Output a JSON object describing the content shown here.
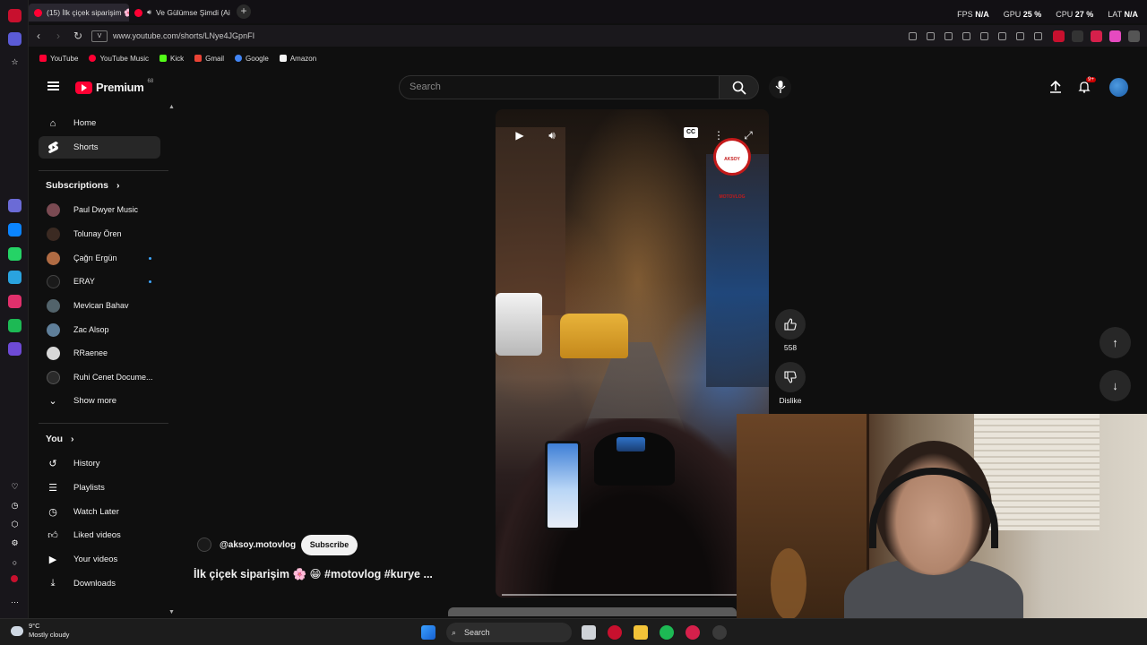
{
  "browser": {
    "tabs": [
      {
        "label": "(15) İlk çiçek siparişim 🌸 S",
        "active": true
      },
      {
        "label": "Ve Gülümse Şimdi (Ai",
        "active": false
      }
    ],
    "stats": {
      "fps_label": "FPS",
      "fps_value": "N/A",
      "gpu_label": "GPU",
      "gpu_value": "25 %",
      "cpu_label": "CPU",
      "cpu_value": "27 %",
      "lat_label": "LAT",
      "lat_value": "N/A"
    },
    "url": "www.youtube.com/shorts/LNye4JGpnFI",
    "vbadge": "V",
    "bookmarks": [
      "YouTube",
      "YouTube Music",
      "Kick",
      "Gmail",
      "Google",
      "Amazon"
    ]
  },
  "youtube": {
    "logo_text": "Premium",
    "logo_sup": "68",
    "search_placeholder": "Search",
    "notif_count": "9+",
    "sidebar": {
      "main": [
        {
          "label": "Home",
          "icon": "home-icon"
        },
        {
          "label": "Shorts",
          "icon": "shorts-icon",
          "active": true
        }
      ],
      "subscriptions_heading": "Subscriptions",
      "subscriptions": [
        {
          "name": "Paul Dwyer Music",
          "dot": false,
          "color": "#7a4a52"
        },
        {
          "name": "Tolunay Ören",
          "dot": false,
          "color": "#3b2a22"
        },
        {
          "name": "Çağrı Ergün",
          "dot": true,
          "color": "#b06b43"
        },
        {
          "name": "ERAY",
          "dot": true,
          "color": "#1a1a1a"
        },
        {
          "name": "Mevlcan Bahav",
          "dot": false,
          "color": "#52636b"
        },
        {
          "name": "Zac Alsop",
          "dot": false,
          "color": "#5f7f9a"
        },
        {
          "name": "RRaenee",
          "dot": false,
          "color": "#d8d8d8"
        },
        {
          "name": "Ruhi Cenet Docume...",
          "dot": false,
          "color": "#2a2a2a"
        }
      ],
      "show_more": "Show more",
      "you_heading": "You",
      "you_items": [
        {
          "label": "History",
          "icon": "history-icon"
        },
        {
          "label": "Playlists",
          "icon": "playlists-icon"
        },
        {
          "label": "Watch Later",
          "icon": "watch-later-icon"
        },
        {
          "label": "Liked videos",
          "icon": "liked-videos-icon"
        },
        {
          "label": "Your videos",
          "icon": "your-videos-icon"
        },
        {
          "label": "Downloads",
          "icon": "downloads-icon"
        }
      ]
    },
    "short": {
      "channel": "@aksoy.motovlog",
      "subscribe_label": "Subscribe",
      "title": "İlk çiçek siparişim 🌸 😁 #motovlog #kurye ...",
      "cc_label": "CC",
      "stamp_text": "AKSOY MOTOVLOG",
      "like_count": "558",
      "dislike_label": "Dislike"
    }
  },
  "taskbar": {
    "weather_temp": "9°C",
    "weather_desc": "Mostly cloudy",
    "search_label": "Search"
  }
}
